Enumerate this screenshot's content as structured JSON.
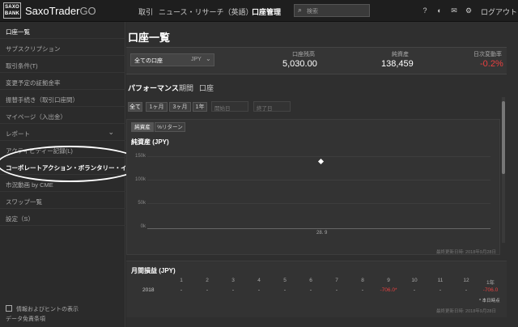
{
  "brand": {
    "logo_line1": "SAXO",
    "logo_line2": "BANK",
    "name": "SaxoTrader",
    "suffix": "GO"
  },
  "nav": [
    {
      "label": "取引"
    },
    {
      "label": "ニュース・リサーチ（英語）"
    },
    {
      "label": "口座管理"
    }
  ],
  "search": {
    "placeholder": "検索"
  },
  "topbar": {
    "logout": "ログアウト"
  },
  "sidebar": {
    "items": [
      {
        "label": "口座一覧"
      },
      {
        "label": "サブスクリプション"
      },
      {
        "label": "取引条件(T)"
      },
      {
        "label": "変更予定の証拠金率"
      },
      {
        "label": "振替手続き（取引口座間）"
      },
      {
        "label": "マイページ（入出金）"
      },
      {
        "label": "レポート"
      },
      {
        "label": "アクティビティー記録(L)"
      },
      {
        "label": "コーポレートアクション・ボランタリー・イ・"
      },
      {
        "label": "市況動画 by CME"
      },
      {
        "label": "スワップ一覧"
      },
      {
        "label": "設定（S）"
      }
    ],
    "footer_check": "情報およびヒントの表示",
    "footer_link": "データ免責条項"
  },
  "page": {
    "title": "口座一覧"
  },
  "account": {
    "name": "全ての口座",
    "currency": "JPY"
  },
  "stats": [
    {
      "label": "口座残高",
      "value": "5,030.00"
    },
    {
      "label": "純資産",
      "value": "138,459"
    },
    {
      "label": "日次変動率",
      "value": "-0.2%"
    }
  ],
  "tabs": [
    {
      "label": "パフォーマンス"
    },
    {
      "label": "期間"
    },
    {
      "label": "口座"
    }
  ],
  "period": {
    "buttons": [
      {
        "label": "全て"
      },
      {
        "label": "1ヶ月"
      },
      {
        "label": "3ヶ月"
      },
      {
        "label": "1年"
      }
    ],
    "start_placeholder": "開始日",
    "end_placeholder": "終了日"
  },
  "chart_toggle": [
    {
      "label": "純資産"
    },
    {
      "label": "%リターン"
    }
  ],
  "chart_data": {
    "type": "scatter",
    "title": "純資産 (JPY)",
    "ytick_labels": [
      "150k",
      "100k",
      "50k",
      "0k"
    ],
    "ylim": [
      0,
      150000
    ],
    "points": [
      {
        "x": "28. 9",
        "y": 138459
      }
    ],
    "updated": "最終更新日時: 2018年9月28日",
    "grid": true
  },
  "monthly": {
    "title": "月間損益 (JPY)",
    "headers": [
      "1",
      "2",
      "3",
      "4",
      "5",
      "6",
      "7",
      "8",
      "9",
      "10",
      "11",
      "12",
      "1年"
    ],
    "year": "2018",
    "values": [
      "-",
      "-",
      "-",
      "-",
      "-",
      "-",
      "-",
      "-",
      "-706.0*",
      "-",
      "-",
      "-",
      "-706.0"
    ],
    "note": "* 本日時点",
    "updated": "最終更新日時: 2018年9月28日"
  },
  "colors": {
    "negative": "#e84040",
    "background": "#2b2b2b"
  }
}
